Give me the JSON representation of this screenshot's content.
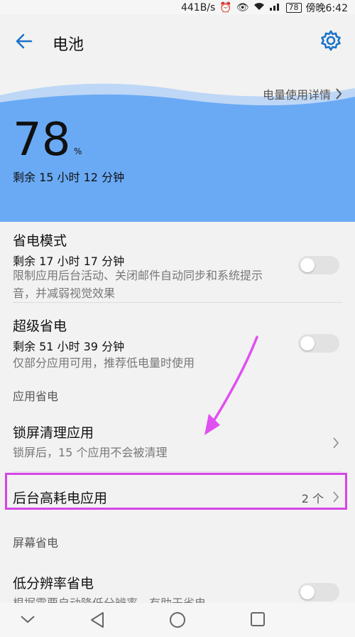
{
  "status": {
    "speed": "441B/s",
    "battery_level": "78",
    "carrier_time": "傍晚6:42"
  },
  "header": {
    "title": "电池"
  },
  "hero": {
    "usage_details": "电量使用详情",
    "battery_percent": "78",
    "percent_sign": "%",
    "remaining": "剩余 15 小时 12 分钟"
  },
  "power_saving": {
    "title": "省电模式",
    "remaining": "剩余 17 小时 17 分钟",
    "desc": "限制应用后台活动、关闭邮件自动同步和系统提示音，并减弱视觉效果"
  },
  "super_saving": {
    "title": "超级省电",
    "remaining": "剩余 51 小时 39 分钟",
    "desc": "仅部分应用可用，推荐低电量时使用"
  },
  "app_section": {
    "header": "应用省电",
    "lock_clean": {
      "title": "锁屏清理应用",
      "desc": "锁屏后，15 个应用不会被清理"
    },
    "background_apps": {
      "title": "后台高耗电应用",
      "count": "2 个"
    }
  },
  "screen_section": {
    "header": "屏幕省电",
    "low_res": {
      "title": "低分辨率省电",
      "desc": "根据需要自动降低分辨率，有助于省电"
    }
  },
  "colors": {
    "accent": "#1a73c9",
    "hero_blue": "#6aaaf5",
    "highlight": "#d646e6"
  }
}
